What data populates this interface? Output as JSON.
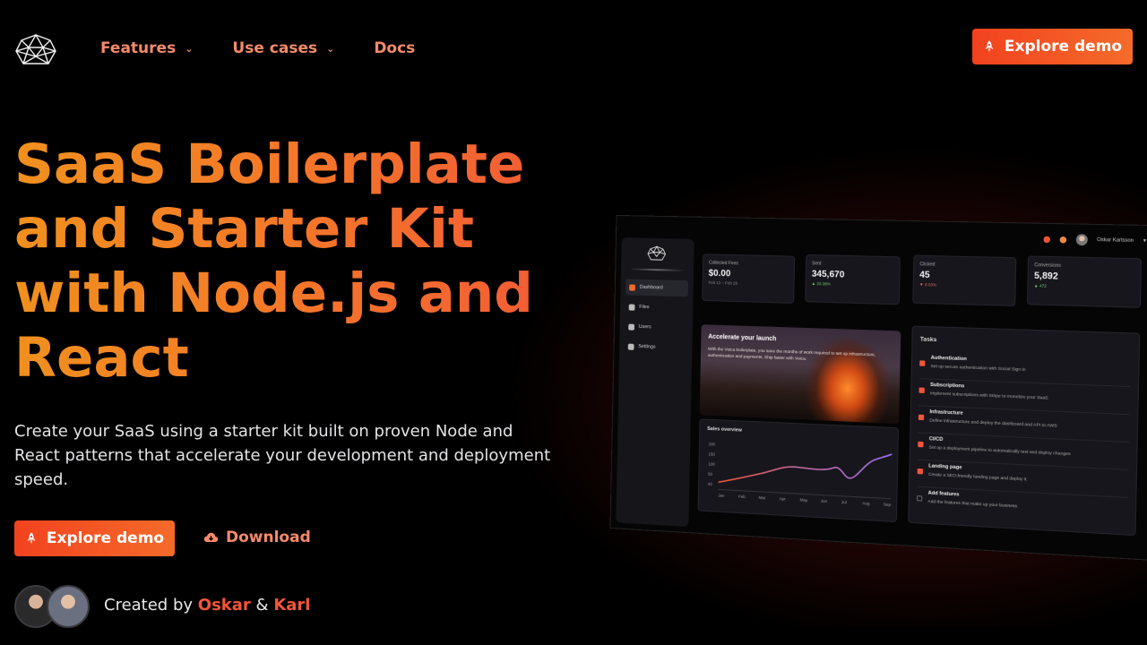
{
  "nav": {
    "items": [
      {
        "label": "Features",
        "has_dropdown": true
      },
      {
        "label": "Use cases",
        "has_dropdown": true
      },
      {
        "label": "Docs",
        "has_dropdown": false
      }
    ],
    "cta_label": "Explore demo",
    "cta_icon": "rocket-icon",
    "accent": "#f2421f"
  },
  "hero": {
    "title": "SaaS Boilerplate and Starter Kit with Node.js and React",
    "subtitle": "Create your SaaS using a starter kit built on proven Node and React patterns that accelerate your development and deployment speed.",
    "primary_cta": "Explore demo",
    "secondary_cta": "Download",
    "secondary_icon": "cloud-download-icon",
    "credits": {
      "prefix": "Created by",
      "author1": "Oskar",
      "separator": "&",
      "author2": "Karl"
    }
  },
  "mockup": {
    "user_name": "Oskar Karlsson",
    "sidebar": [
      "Dashboard",
      "Files",
      "Users",
      "Settings"
    ],
    "stats": [
      {
        "label": "Collected Fees",
        "value": "$0.00",
        "sub": "Feb 12 – Feb 28"
      },
      {
        "label": "Sent",
        "value": "345,670",
        "sub": "▲ 23.36%"
      },
      {
        "label": "Clicked",
        "value": "45",
        "sub": "▼ 0.03%"
      },
      {
        "label": "Conversions",
        "value": "5,892",
        "sub": "▲ 472"
      }
    ],
    "banner": {
      "title": "Accelerate your launch",
      "text": "With the Voica boilerplate, you save the months of work required to set up infrastructure, authentication and payments. Ship faster with Voica."
    },
    "chart": {
      "title": "Sales overview",
      "y_ticks": [
        "200",
        "150",
        "100",
        "50",
        "40"
      ],
      "months": [
        "Jan",
        "Feb",
        "Mar",
        "Apr",
        "May",
        "Jun",
        "Jul",
        "Aug",
        "Sep"
      ]
    },
    "tasks_title": "Tasks",
    "tasks": [
      {
        "title": "Authentication",
        "desc": "Set up secure authentication with Social Sign in",
        "done": true
      },
      {
        "title": "Subscriptions",
        "desc": "Implement subscriptions with Stripe to monetize your SaaS",
        "done": true
      },
      {
        "title": "Infrastructure",
        "desc": "Define infrastructure and deploy the dashboard and API to AWS",
        "done": true
      },
      {
        "title": "CI/CD",
        "desc": "Set up a deployment pipeline to automatically test and deploy changes",
        "done": true
      },
      {
        "title": "Landing page",
        "desc": "Create a SEO-friendly landing page and deploy it.",
        "done": true
      },
      {
        "title": "Add features",
        "desc": "Add the features that make up your business.",
        "done": false
      }
    ]
  }
}
